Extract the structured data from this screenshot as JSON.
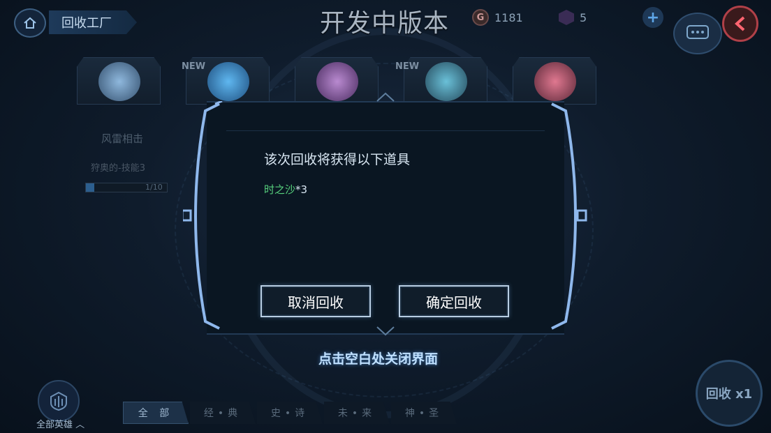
{
  "topbar": {
    "home_icon": "home-icon",
    "title": "回收工厂",
    "dev_version": "开发中版本",
    "gold_icon": "G",
    "gold": "1181",
    "gem": "5",
    "plus": "+"
  },
  "items": {
    "new_label_1": "NEW",
    "new_label_2": "NEW"
  },
  "left_card": {
    "name": "风雷相击",
    "desc": "狩奥的-技能3",
    "count": "1/10"
  },
  "dialog": {
    "title": "该次回收将获得以下道具",
    "reward_name": "时之沙",
    "reward_qty": "*3",
    "cancel_label": "取消回收",
    "confirm_label": "确定回收"
  },
  "close_hint": "点击空白处关闭界面",
  "bottom": {
    "all_heroes_label": "全部英雄",
    "filters": [
      "全 部",
      "经•典",
      "史•诗",
      "未•来",
      "神•圣"
    ],
    "recycle_label": "回收 x1"
  },
  "colors": {
    "reward_green": "#57d17d",
    "button_border": "#b9cee3",
    "hint_blue": "#bfe0ff"
  }
}
